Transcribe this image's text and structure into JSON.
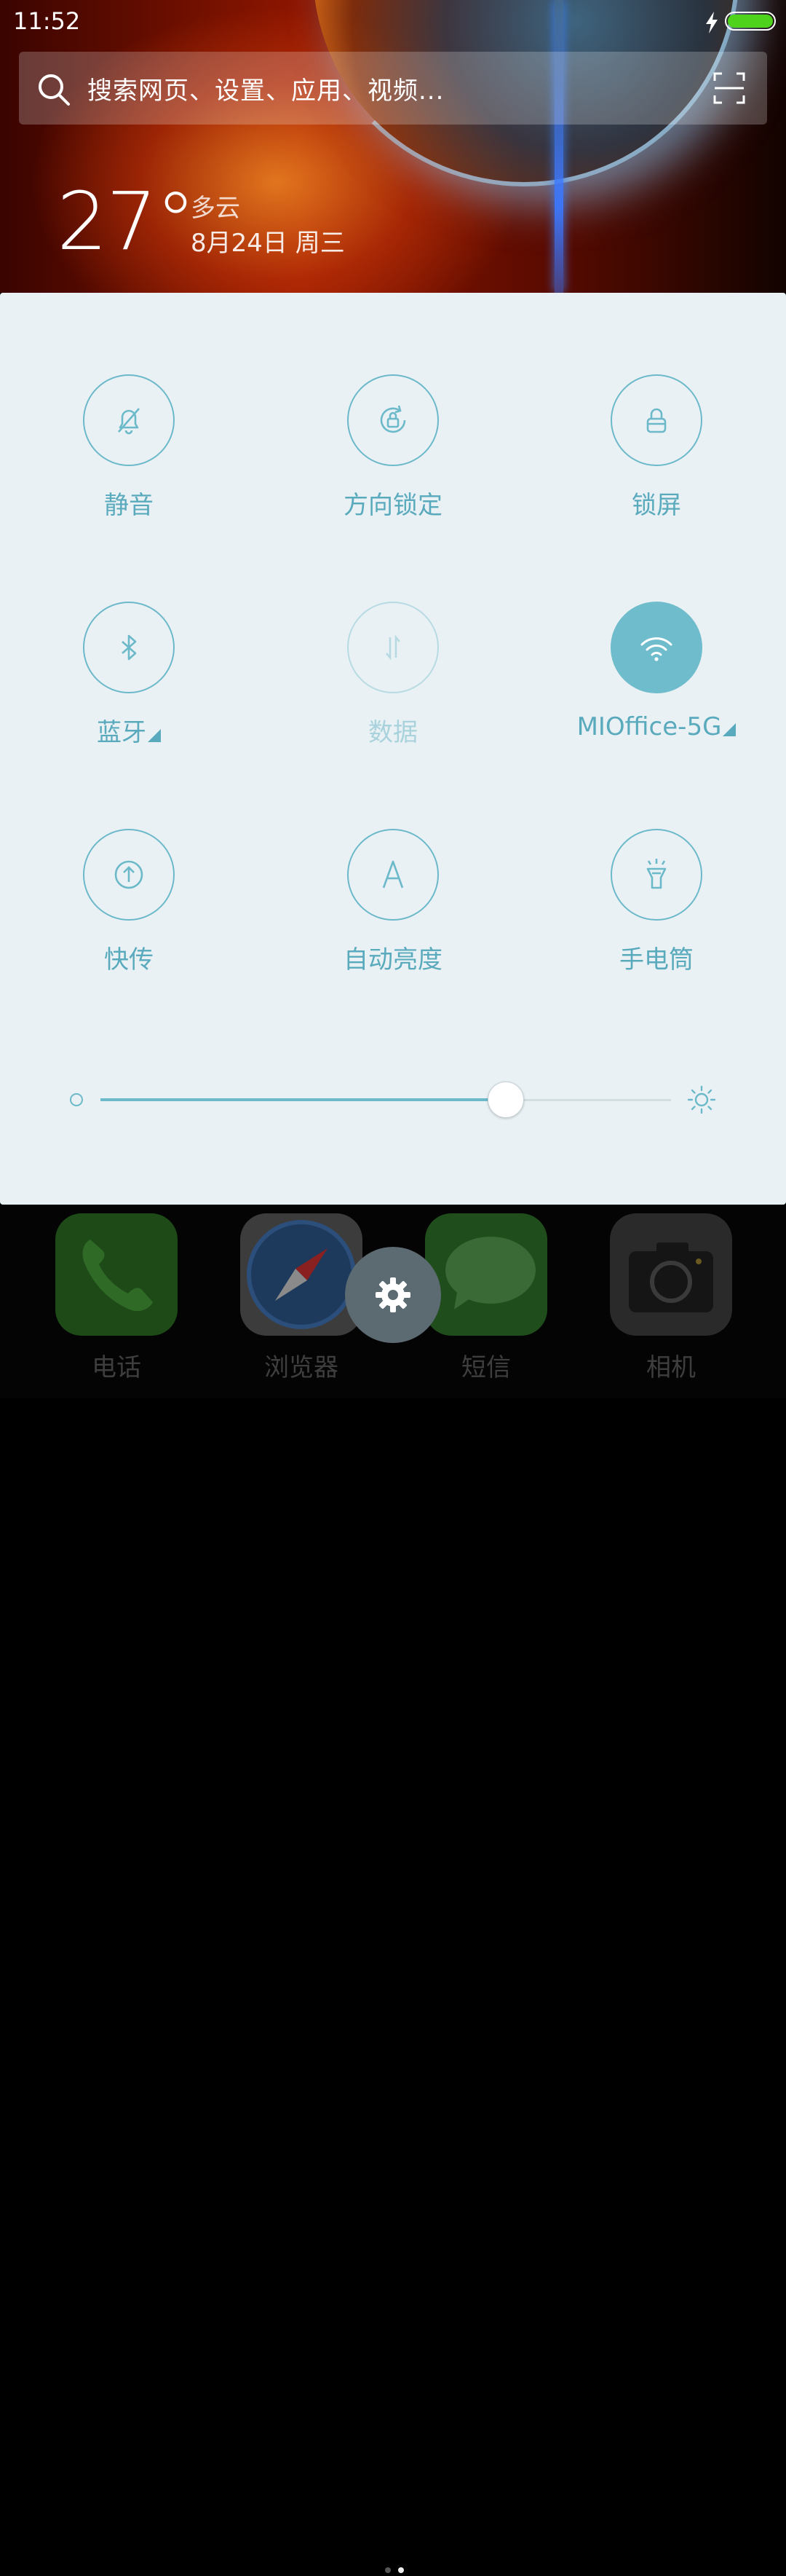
{
  "status_bar": {
    "time": "11:52"
  },
  "search": {
    "placeholder": "搜索网页、设置、应用、视频..."
  },
  "weather": {
    "temperature": "27°",
    "condition": "多云",
    "date": "8月24日 周三"
  },
  "toggles": [
    {
      "label": "静音",
      "icon": "bell-off-icon",
      "state": "off"
    },
    {
      "label": "方向锁定",
      "icon": "rotation-lock-icon",
      "state": "off"
    },
    {
      "label": "锁屏",
      "icon": "lock-icon",
      "state": "off"
    },
    {
      "label": "蓝牙",
      "icon": "bluetooth-icon",
      "state": "off",
      "expand": true
    },
    {
      "label": "数据",
      "icon": "data-arrows-icon",
      "state": "disabled"
    },
    {
      "label": "MIOffice-5G",
      "icon": "wifi-icon",
      "state": "on",
      "expand": true
    },
    {
      "label": "快传",
      "icon": "upload-icon",
      "state": "off"
    },
    {
      "label": "自动亮度",
      "icon": "letter-a-icon",
      "state": "off"
    },
    {
      "label": "手电筒",
      "icon": "flashlight-icon",
      "state": "off"
    }
  ],
  "brightness": {
    "level_fraction": 0.71
  },
  "dock": {
    "apps": [
      {
        "label": "电话",
        "icon": "phone-icon"
      },
      {
        "label": "浏览器",
        "icon": "compass-icon"
      },
      {
        "label": "短信",
        "icon": "message-bubble-icon"
      },
      {
        "label": "相机",
        "icon": "camera-icon"
      }
    ],
    "pages": 2,
    "current_page": 2
  },
  "colors": {
    "accent": "#6cb9ca",
    "panel_bg": "#eaf1f4",
    "battery": "#4ed21c"
  }
}
